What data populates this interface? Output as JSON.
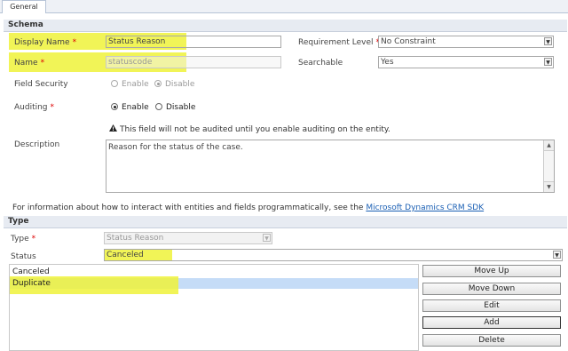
{
  "tabs": [
    {
      "label": "General"
    }
  ],
  "schema": {
    "header": "Schema",
    "display_name": {
      "label": "Display Name",
      "value": "Status Reason"
    },
    "name": {
      "label": "Name",
      "value": "statuscode"
    },
    "requirement_level": {
      "label": "Requirement Level",
      "value": "No Constraint"
    },
    "searchable": {
      "label": "Searchable",
      "value": "Yes"
    },
    "field_security": {
      "label": "Field Security",
      "enable": "Enable",
      "disable": "Disable",
      "selected": "Disable"
    },
    "auditing": {
      "label": "Auditing",
      "enable": "Enable",
      "disable": "Disable",
      "selected": "Enable",
      "warning": "This field will not be audited until you enable auditing on the entity."
    },
    "description": {
      "label": "Description",
      "value": "Reason for the status of the case."
    },
    "required_mark": "*"
  },
  "info": {
    "text": "For information about how to interact with entities and fields programmatically, see the",
    "link": "Microsoft Dynamics CRM SDK"
  },
  "type_section": {
    "header": "Type",
    "type": {
      "label": "Type",
      "value": "Status Reason"
    },
    "status": {
      "label": "Status",
      "value": "Canceled"
    },
    "options": [
      {
        "label": "Canceled"
      },
      {
        "label": "Duplicate"
      }
    ],
    "buttons": {
      "move_up": "Move Up",
      "move_down": "Move Down",
      "edit": "Edit",
      "add": "Add",
      "delete": "Delete"
    }
  },
  "colors": {
    "highlight": "#eef23a",
    "selected_row": "#c5dcf7",
    "link": "#1a5fb4",
    "required": "#dd0000"
  },
  "icons": {
    "dropdown": "chevron-down-icon",
    "warning": "warning-icon"
  }
}
